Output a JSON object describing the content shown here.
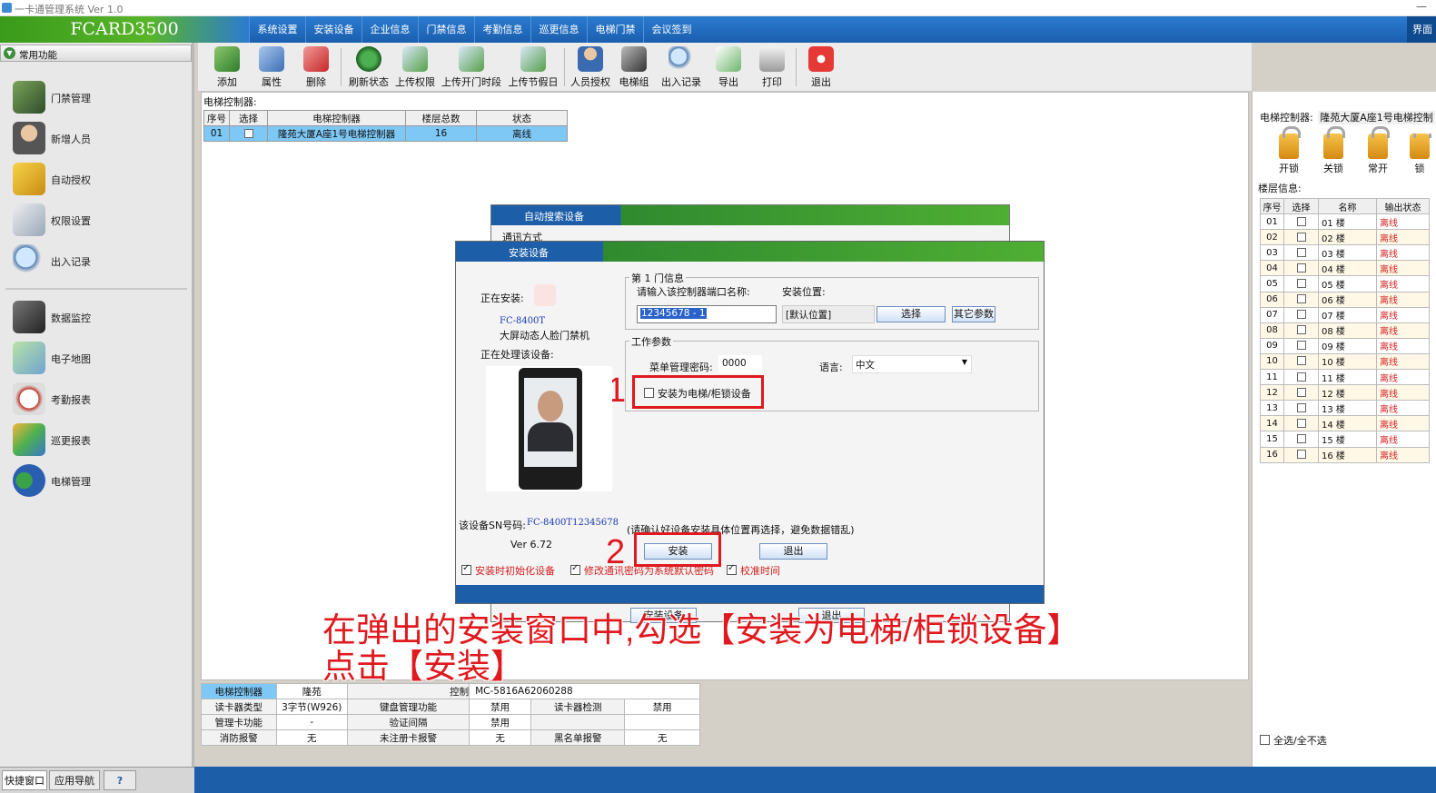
{
  "window": {
    "title": "一卡通管理系统  Ver 1.0",
    "min": "—"
  },
  "brand": "FCARD3500",
  "menu": [
    "系统设置",
    "安装设备",
    "企业信息",
    "门禁信息",
    "考勤信息",
    "巡更信息",
    "电梯门禁",
    "会议签到"
  ],
  "menu_right": "界面",
  "left_panel": {
    "header": "常用功能",
    "items": [
      "门禁管理",
      "新增人员",
      "自动授权",
      "权限设置",
      "出入记录",
      "数据监控",
      "电子地图",
      "考勤报表",
      "巡更报表",
      "电梯管理"
    ],
    "tabs": [
      "快捷窗口",
      "应用导航",
      "?"
    ]
  },
  "toolbar": [
    "添加",
    "属性",
    "删除",
    "刷新状态",
    "上传权限",
    "上传开门时段",
    "上传节假日",
    "人员授权",
    "电梯组",
    "出入记录",
    "导出",
    "打印",
    "退出"
  ],
  "main": {
    "label": "电梯控制器:",
    "columns": [
      "序号",
      "选择",
      "电梯控制器",
      "楼层总数",
      "状态"
    ],
    "rows": [
      {
        "no": "01",
        "name": "隆苑大厦A座1号电梯控制器",
        "floors": "16",
        "status": "离线"
      }
    ]
  },
  "bg_dialog": {
    "title": "自动搜索设备",
    "sub": "通讯方式",
    "btn1": "安装设备",
    "btn2": "退出"
  },
  "dialog": {
    "title": "安装设备",
    "installing_label": "正在安装:",
    "model": "FC-8400T",
    "device_name": "大屏动态人脸门禁机",
    "processing_label": "正在处理该设备:",
    "door_group": "第 1 门信息",
    "port_label": "请输入该控制器端口名称:",
    "port_value": "12345678 - 1",
    "location_label": "安装位置:",
    "location_value": "[默认位置]",
    "select_btn": "选择",
    "other_btn": "其它参数",
    "work_group": "工作参数",
    "menu_pwd_label": "菜单管理密码:",
    "menu_pwd_value": "0000",
    "lang_label": "语言:",
    "lang_value": "中文",
    "elevator_chk": "安装为电梯/柜锁设备",
    "sn_label": "该设备SN号码:",
    "sn_value": "FC-8400T12345678",
    "warning": "(请确认好设备安装具体位置再选择，避免数据错乱)",
    "version": "Ver 6.72",
    "install_btn": "安装",
    "exit_btn": "退出",
    "chk1": "安装时初始化设备",
    "chk2": "修改通讯密码为系统默认密码",
    "chk3": "校准时间",
    "step1": "1",
    "step2": "2"
  },
  "caption": {
    "line1": "在弹出的安装窗口中,勾选【安装为电梯/柜锁设备】",
    "line2": "点击【安装】"
  },
  "info": {
    "r1": [
      "电梯控制器",
      "隆苑",
      "控制",
      "MC-5816A62060288"
    ],
    "r2": [
      "读卡器类型",
      "3字节(W926)",
      "键盘管理功能",
      "禁用",
      "读卡器检测",
      "禁用"
    ],
    "r3": [
      "管理卡功能",
      "-",
      "验证间隔",
      "禁用"
    ],
    "r4": [
      "消防报警",
      "无",
      "未注册卡报警",
      "无",
      "黑名单报警",
      "无"
    ]
  },
  "right_panel": {
    "ctrl_label": "电梯控制器:",
    "ctrl_value": "隆苑大厦A座1号电梯控制",
    "locks": [
      "开锁",
      "关锁",
      "常开",
      "锁"
    ],
    "floor_label": "楼层信息:",
    "columns": [
      "序号",
      "选择",
      "名称",
      "输出状态"
    ],
    "floors": [
      [
        "01",
        "01 楼",
        "离线"
      ],
      [
        "02",
        "02 楼",
        "离线"
      ],
      [
        "03",
        "03 楼",
        "离线"
      ],
      [
        "04",
        "04 楼",
        "离线"
      ],
      [
        "05",
        "05 楼",
        "离线"
      ],
      [
        "06",
        "06 楼",
        "离线"
      ],
      [
        "07",
        "07 楼",
        "离线"
      ],
      [
        "08",
        "08 楼",
        "离线"
      ],
      [
        "09",
        "09 楼",
        "离线"
      ],
      [
        "10",
        "10 楼",
        "离线"
      ],
      [
        "11",
        "11 楼",
        "离线"
      ],
      [
        "12",
        "12 楼",
        "离线"
      ],
      [
        "13",
        "13 楼",
        "离线"
      ],
      [
        "14",
        "14 楼",
        "离线"
      ],
      [
        "15",
        "15 楼",
        "离线"
      ],
      [
        "16",
        "16 楼",
        "离线"
      ]
    ],
    "select_all": "全选/全不选"
  },
  "colors": {
    "accent_blue": "#1d5ea8",
    "accent_green": "#3a9a1a",
    "highlight": "#e0191e",
    "selected_row": "#7ec8f5"
  }
}
